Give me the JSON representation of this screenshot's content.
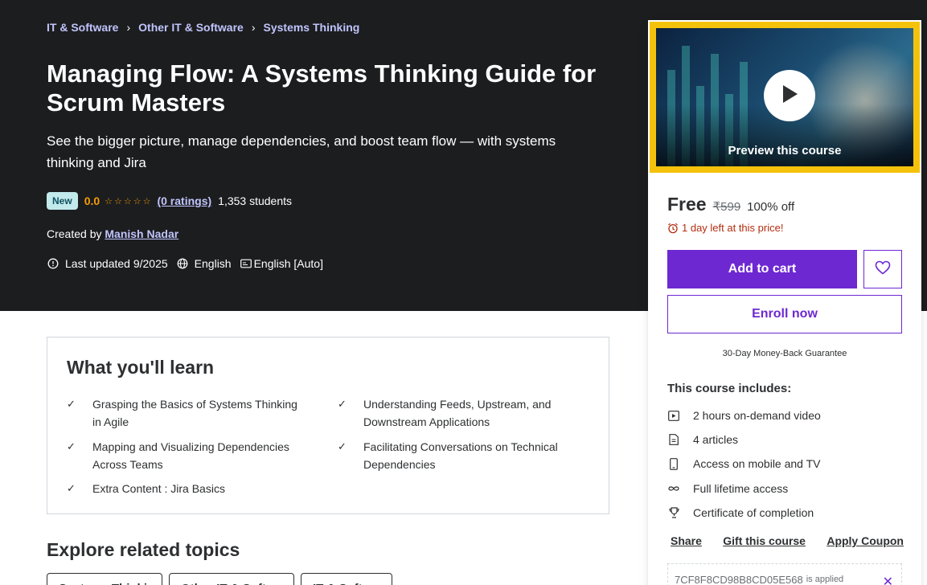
{
  "breadcrumb": {
    "items": [
      "IT & Software",
      "Other IT & Software",
      "Systems Thinking"
    ]
  },
  "course": {
    "title": "Managing Flow: A Systems Thinking Guide for Scrum Masters",
    "subtitle": "See the bigger picture, manage dependencies, and boost team flow — with systems thinking and Jira",
    "badge": "New",
    "rating": "0.0",
    "stars": "☆☆☆☆☆",
    "ratings_link": "(0 ratings)",
    "students": "1,353 students",
    "created_by_label": "Created by",
    "instructor": "Manish Nadar",
    "last_updated": "Last updated 9/2025",
    "language": "English",
    "captions": "English [Auto]"
  },
  "learn": {
    "title": "What you'll learn",
    "items": [
      "Grasping the Basics of Systems Thinking in Agile",
      "Understanding Feeds, Upstream, and Downstream Applications",
      "Mapping and Visualizing Dependencies Across Teams",
      "Facilitating Conversations on Technical Dependencies",
      "Extra Content : Jira Basics"
    ]
  },
  "explore": {
    "title": "Explore related topics",
    "topics": [
      "Systems Thinking",
      "Other IT & Software",
      "IT & Software"
    ]
  },
  "sidebar": {
    "preview_label": "Preview this course",
    "price": "Free",
    "original_price": "₹599",
    "discount": "100% off",
    "deadline": "1 day left at this price!",
    "add_to_cart": "Add to cart",
    "enroll": "Enroll now",
    "guarantee": "30-Day Money-Back Guarantee",
    "includes_title": "This course includes:",
    "includes": [
      "2 hours on-demand video",
      "4 articles",
      "Access on mobile and TV",
      "Full lifetime access",
      "Certificate of completion"
    ],
    "actions": [
      "Share",
      "Gift this course",
      "Apply Coupon"
    ],
    "coupon_code": "7CF8F8CD98B8CD05E568",
    "coupon_status": "is applied"
  },
  "colors": {
    "hero_bg": "#1c1d1f",
    "accent_purple": "#6d28d2",
    "rating_orange": "#f69c08",
    "link_lavender": "#c0c4fc",
    "deadline_red": "#b32d0f"
  }
}
